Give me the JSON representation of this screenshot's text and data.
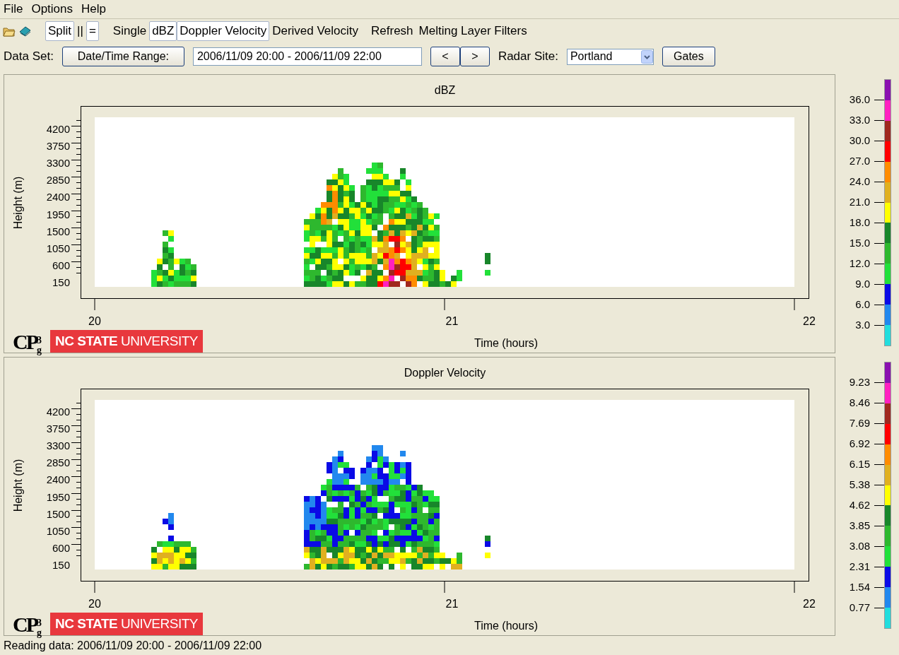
{
  "menu": [
    "File",
    "Options",
    "Help"
  ],
  "toolbar": [
    {
      "label": "Split",
      "selected": true
    },
    {
      "label": "||",
      "selected": false
    },
    {
      "label": "=",
      "selected": true
    },
    {
      "label": "Single",
      "selected": false
    },
    {
      "label": "dBZ",
      "selected": true
    },
    {
      "label": "Doppler Velocity",
      "selected": true
    },
    {
      "label": "Derived Velocity",
      "selected": false
    },
    {
      "label": "Refresh",
      "selected": false
    },
    {
      "label": "Melting Layer Filters",
      "selected": false
    }
  ],
  "dataset": {
    "label": "Data Set:",
    "range_button": "Date/Time Range:",
    "range_value": "2006/11/09 20:00 - 2006/11/09 22:00",
    "prev": "<",
    "next": ">",
    "site_label": "Radar Site:",
    "site_value": "Portland",
    "gates_button": "Gates"
  },
  "panels": [
    {
      "title": "dBZ",
      "ylabel": "Height (m)",
      "yticks": [
        "4200",
        "3750",
        "3300",
        "2850",
        "2400",
        "1950",
        "1500",
        "1050",
        "600",
        "150"
      ],
      "xticks": [
        "20",
        "21",
        "22"
      ],
      "xlabel": "Time (hours)",
      "logo": {
        "main": "CP",
        "sup": "3",
        "sub": "g"
      },
      "university": "**NC STATE** UNIVERSITY",
      "colorbar": {
        "labels": [
          "36.0",
          "33.0",
          "30.0",
          "27.0",
          "24.0",
          "21.0",
          "18.0",
          "15.0",
          "12.0",
          "9.0",
          "6.0",
          "3.0"
        ],
        "segments": [
          {
            "color": "#8a10b0"
          },
          {
            "color": "#ff20c0"
          },
          {
            "color": "#a0281e"
          },
          {
            "color": "#ff0000"
          },
          {
            "color": "#ff8c00"
          },
          {
            "color": "#e0b020"
          },
          {
            "color": "#ffff00"
          },
          {
            "color": "#18862a"
          },
          {
            "color": "#2eb82e"
          },
          {
            "color": "#22e03a"
          },
          {
            "color": "#0a0ae6"
          },
          {
            "color": "#2288ee"
          },
          {
            "color": "#22dddd"
          }
        ]
      }
    },
    {
      "title": "Doppler Velocity",
      "ylabel": "Height (m)",
      "yticks": [
        "4200",
        "3750",
        "3300",
        "2850",
        "2400",
        "1950",
        "1500",
        "1050",
        "600",
        "150"
      ],
      "xticks": [
        "20",
        "21",
        "22"
      ],
      "xlabel": "Time (hours)",
      "logo": {
        "main": "CP",
        "sup": "3",
        "sub": "g"
      },
      "university": "**NC STATE** UNIVERSITY",
      "colorbar": {
        "labels": [
          "9.23",
          "8.46",
          "7.69",
          "6.92",
          "6.15",
          "5.38",
          "4.62",
          "3.85",
          "3.08",
          "2.31",
          "1.54",
          "0.77"
        ],
        "segments": [
          {
            "color": "#8a10b0"
          },
          {
            "color": "#ff20c0"
          },
          {
            "color": "#a0281e"
          },
          {
            "color": "#ff0000"
          },
          {
            "color": "#ff8c00"
          },
          {
            "color": "#e0b020"
          },
          {
            "color": "#ffff00"
          },
          {
            "color": "#18862a"
          },
          {
            "color": "#2eb82e"
          },
          {
            "color": "#22e03a"
          },
          {
            "color": "#0a0ae6"
          },
          {
            "color": "#2288ee"
          },
          {
            "color": "#22dddd"
          }
        ]
      }
    }
  ],
  "status_bar": "Reading data: 2006/11/09 20:00 - 2006/11/09 22:00"
}
